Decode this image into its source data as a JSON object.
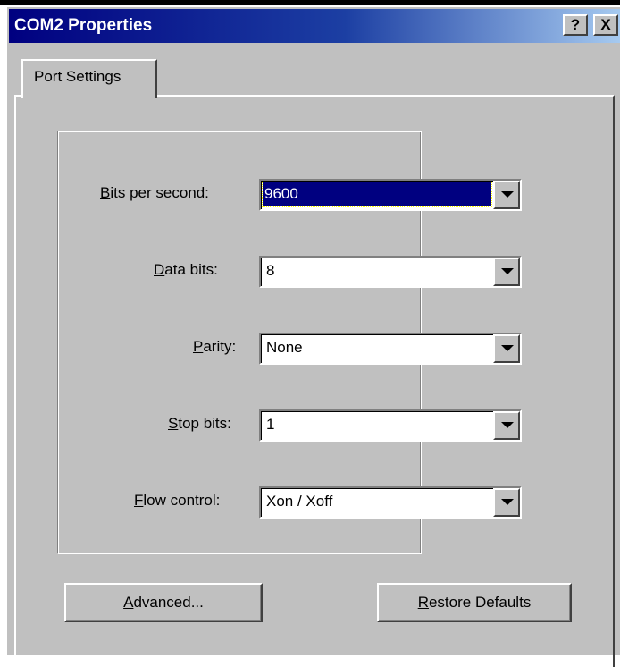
{
  "window": {
    "title": "COM2 Properties",
    "help_label": "?",
    "close_label": "X"
  },
  "tabs": [
    {
      "label": "Port Settings",
      "active": true
    }
  ],
  "fields": {
    "bits_per_second": {
      "label_prefix": "",
      "label_mnemonic": "B",
      "label_rest": "its per second:",
      "value": "9600"
    },
    "data_bits": {
      "label_mnemonic": "D",
      "label_rest": "ata bits:",
      "value": "8"
    },
    "parity": {
      "label_mnemonic": "P",
      "label_rest": "arity:",
      "value": "None"
    },
    "stop_bits": {
      "label_mnemonic": "S",
      "label_rest": "top bits:",
      "value": "1"
    },
    "flow_control": {
      "label_mnemonic": "F",
      "label_rest": "low control:",
      "value": "Xon / Xoff"
    }
  },
  "buttons": {
    "advanced": {
      "mnemonic": "A",
      "rest": "dvanced..."
    },
    "restore_defaults": {
      "mnemonic": "R",
      "rest": "estore Defaults"
    }
  },
  "colors": {
    "face": "#c0c0c0",
    "title_start": "#000080",
    "title_end": "#a6caf0",
    "selection": "#000080"
  }
}
